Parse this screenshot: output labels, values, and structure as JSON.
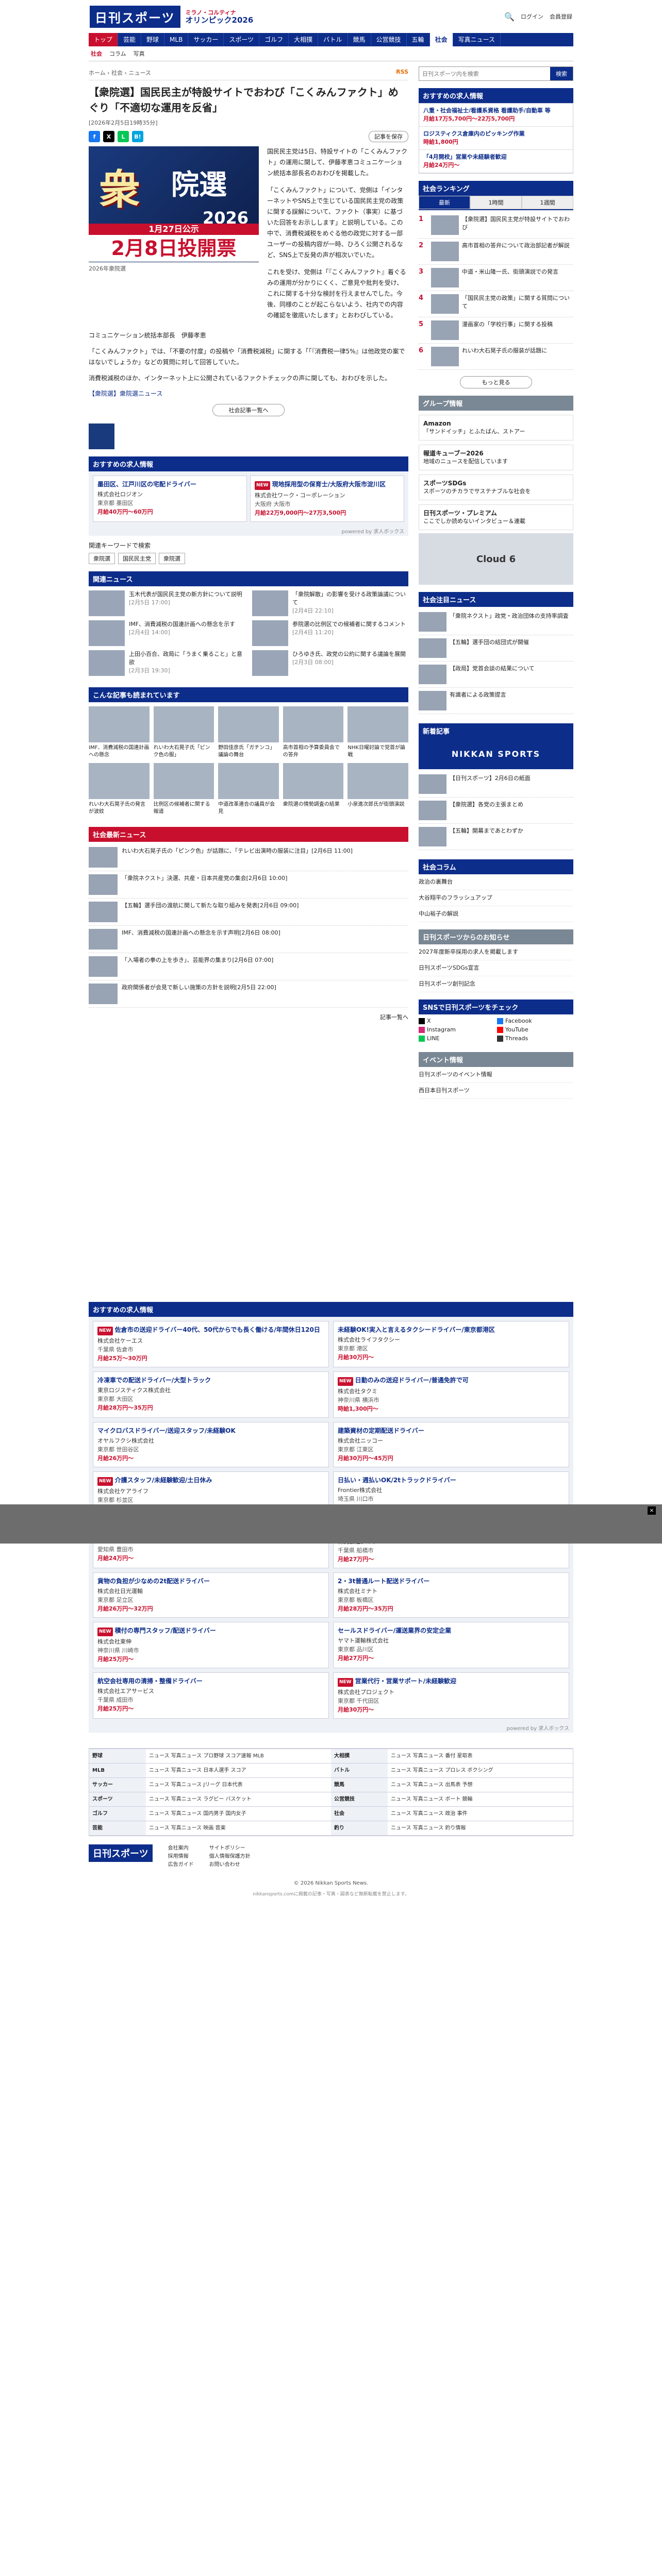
{
  "header": {
    "logo": "日刊スポーツ",
    "olympic_line1": "ミラノ・コルティナ",
    "olympic_line2": "オリンピック2026",
    "login": "ログイン",
    "member": "会員登録"
  },
  "nav": [
    "トップ",
    "芸能",
    "野球",
    "MLB",
    "サッカー",
    "スポーツ",
    "ゴルフ",
    "大相撲",
    "バトル",
    "競馬",
    "公営競技",
    "五輪",
    "社会",
    "写真ニュース"
  ],
  "subnav": [
    "社会",
    "コラム",
    "写真"
  ],
  "breadcrumb": "ホーム › 社会 › ニュース",
  "rss": "RSS",
  "article": {
    "title": "【衆院選】国民民主が特設サイトでおわび「こくみんファクト」めぐり「不適切な運用を反省」",
    "date": "[2026年2月5日19時35分]",
    "save": "記事を保存",
    "photo_band1": "1月27日公示",
    "photo_band2": "2月8日投開票",
    "caption": "2026年衆院選",
    "paragraphs": [
      "国民民主党は5日、特設サイトの「こくみんファクト」の運用に関して、伊藤孝恵コミュニケーション統括本部長名のおわびを掲載した。",
      "「こくみんファクト」について、党側は「インターネットやSNS上で生じている国民民主党の政策に関する誤解について、ファクト（事実）に基づいた回答をお示しします」と説明している。この中で、消費税減税をめぐる他の政党に対する一部ユーザーの投稿内容が一時、ひろく公開されるなど、SNS上で反発の声が相次いでいた。",
      "これを受け、党側は「『こくみんファクト』着ぐるみの運用が分かりにくく、ご意見や批判を受け、これに関する十分な検討を行えませんでした。今後、同様のことが起こらないよう、社内での内容の確認を徹底いたします」とおわびしている。",
      "コミュニケーション統括本部長　伊藤孝恵"
    ],
    "full": [
      "「こくみんファクト」では、「不要の忖度」の投稿や「消費税減税」に関する「「『消費税一律5%』は他政党の案ではないでしょうか」などの質問に対して回答していた。",
      "消費税減税のほか、インターネット上に公開されているファクトチェックの声に関しても、おわびを示した。"
    ],
    "related": "【衆院選】衆院選ニュース",
    "more": "社会記事一覧へ"
  },
  "jobs_top": {
    "heading": "おすすめの求人情報",
    "items": [
      {
        "title": "墨田区、江戸川区の宅配ドライバー",
        "company": "株式会社ロジオン",
        "loc": "東京都 墨田区",
        "pay": "月給40万円〜60万円"
      },
      {
        "title": "現地採用型の保育士/大阪府大阪市淀川区",
        "company": "株式会社ワーク・コーポレーション",
        "loc": "大阪府 大阪市",
        "pay": "月給22万9,000円〜27万3,500円"
      }
    ],
    "powered": "powered by 求人ボックス"
  },
  "keywords": {
    "label": "関連キーワードで検索",
    "tags": [
      "衆院選",
      "国民民主党",
      "衆院選"
    ]
  },
  "related_news": {
    "heading": "関連ニュース",
    "items": [
      {
        "text": "玉木代表が国民民主党の新方針について説明",
        "time": "[2月5日 17:00]"
      },
      {
        "text": "「衆院解散」の影響を受ける政策論議について",
        "time": "[2月4日 22:10]"
      },
      {
        "text": "IMF、消費減税の国連計画への懸念を示す",
        "time": "[2月4日 14:00]"
      },
      {
        "text": "参院選の比例区での候補者に関するコメント",
        "time": "[2月4日 11:20]"
      },
      {
        "text": "上田小百合、政局に「うまく乗ること」と意欲",
        "time": "[2月3日 19:30]"
      },
      {
        "text": "ひろゆき氏、政党の公約に関する議論を展開",
        "time": "[2月3日 08:00]"
      }
    ]
  },
  "photo_news": {
    "heading": "こんな記事も読まれています",
    "items": [
      "IMF、消費減税の国連計画への懸念",
      "れいわ大石晃子氏「ピンク色の服」",
      "野田佳彦氏「ガチンコ」議論の舞台",
      "高市首相の予算委員会での答弁",
      "NHK日曜討論で党首が論戦",
      "れいわ大石晃子氏の発言が波紋",
      "比例区の候補者に関する報道",
      "中道改革連合の議員が会見",
      "衆院選の情勢調査の結果",
      "小泉進次郎氏が街頭演説"
    ]
  },
  "society_news": {
    "heading": "社会最新ニュース",
    "items": [
      {
        "text": "れいわ大石晃子氏の「ピンク色」が話題に、「テレビ出演時の服装に注目」",
        "time": "[2月6日 11:00]"
      },
      {
        "text": "「衆院ネクスト」決選、共産・日本共産党の集会",
        "time": "[2月6日 10:00]"
      },
      {
        "text": "【五輪】選手団の渡航に関して新たな取り組みを発表",
        "time": "[2月6日 09:00]"
      },
      {
        "text": "IMF、消費減税の国連計画への懸念を示す声明",
        "time": "[2月6日 08:00]"
      },
      {
        "text": "「入場者の拳の上を歩き」、芸能界の集まり",
        "time": "[2月6日 07:00]"
      },
      {
        "text": "政府関係者が会見で新しい施策の方針を説明",
        "time": "[2月5日 22:00]"
      }
    ],
    "more": "記事一覧へ"
  },
  "jobs_bottom": {
    "heading": "おすすめの求人情報",
    "items": [
      {
        "title": "佐倉市の送迎ドライバー40代、50代からでも長く働ける/年間休日120日",
        "company": "株式会社ケーエス",
        "loc": "千葉県 佐倉市",
        "pay": "月給25万〜30万円"
      },
      {
        "title": "未経験OK!実入と言えるタクシードライバー/東京都港区",
        "company": "株式会社ライフタクシー",
        "loc": "東京都 港区",
        "pay": "月給30万円〜"
      },
      {
        "title": "冷凍車での配送ドライバー/大型トラック",
        "company": "東京ロジスティクス株式会社",
        "loc": "東京都 大田区",
        "pay": "月給28万円〜35万円"
      },
      {
        "title": "日勤のみの送迎ドライバー/普通免許で可",
        "company": "株式会社タクミ",
        "loc": "神奈川県 横浜市",
        "pay": "時給1,300円〜"
      },
      {
        "title": "マイクロバスドライバー/送迎スタッフ/未経験OK",
        "company": "オヤルフクシ株式会社",
        "loc": "東京都 世田谷区",
        "pay": "月給26万円〜"
      },
      {
        "title": "建築資材の定期配送ドライバー",
        "company": "株式会社ニッコー",
        "loc": "東京都 江東区",
        "pay": "月給30万円〜45万円"
      },
      {
        "title": "介護スタッフ/未経験歓迎/土日休み",
        "company": "株式会社ケアライフ",
        "loc": "東京都 杉並区",
        "pay": "月給24万円〜"
      },
      {
        "title": "日払い・週払いOK/2tトラックドライバー",
        "company": "Frontier株式会社",
        "loc": "埼玉県 川口市",
        "pay": "月給30万円〜"
      },
      {
        "title": "豊田営業所で倉庫スタッフの送迎ドライバー",
        "company": "フジパンス株式会社",
        "loc": "愛知県 豊田市",
        "pay": "月給24万円〜"
      },
      {
        "title": "普通免許で乗務ドライバー/週休2日",
        "company": "株式会社ダイワ",
        "loc": "千葉県 船橋市",
        "pay": "月給27万円〜"
      },
      {
        "title": "貨物の負担が少なめの2t配送ドライバー",
        "company": "株式会社日光運輸",
        "loc": "東京都 足立区",
        "pay": "月給26万円〜32万円"
      },
      {
        "title": "2・3t普通ルート配送ドライバー",
        "company": "株式会社ミナト",
        "loc": "東京都 板橋区",
        "pay": "月給28万円〜35万円"
      },
      {
        "title": "積付の専門スタッフ/配送ドライバー",
        "company": "株式会社東伸",
        "loc": "神奈川県 川崎市",
        "pay": "月給25万円〜"
      },
      {
        "title": "セールスドライバー/運送業界の安定企業",
        "company": "ヤマト運輸株式会社",
        "loc": "東京都 品川区",
        "pay": "月給27万円〜"
      },
      {
        "title": "航空会社専用の清掃・整備ドライバー",
        "company": "株式会社エアサービス",
        "loc": "千葉県 成田市",
        "pay": "月給25万円〜"
      },
      {
        "title": "営業代行・営業サポート/未経験歓迎",
        "company": "株式会社プロジェクト",
        "loc": "東京都 千代田区",
        "pay": "月給30万円〜"
      }
    ],
    "powered": "powered by 求人ボックス"
  },
  "side": {
    "search_placeholder": "日刊スポーツ内を検索",
    "search_btn": "検索",
    "jobs_heading": "おすすめの求人情報",
    "jobs": [
      {
        "title": "八重・社会福祉士/看護系資格 看護助手/自動車 等",
        "pay": "月給17万5,700円〜22万5,700円"
      },
      {
        "title": "ロジスティクス倉庫内のピッキング作業",
        "pay": "時給1,800円"
      },
      {
        "title": "「4月開校」営業や未経験者歓迎",
        "pay": "月給24万円〜"
      }
    ],
    "ranking_heading": "社会ランキング",
    "ranking_tabs": [
      "最新",
      "1時間",
      "1週間"
    ],
    "ranking": [
      "【衆院選】国民民主党が特設サイトでおわび",
      "高市首相の答弁について政治部記者が解説",
      "中道・米山隆一氏、街頭演説での発言",
      "「国民民主党の政策」に関する質問について",
      "漫画家の「学校行事」に関する投稿",
      "れいわ大石晃子氏の服装が話題に"
    ],
    "ranking_more": "もっと見る",
    "group_heading": "グループ情報",
    "ads": [
      {
        "head": "Amazon",
        "text": "「サンドイッチ」とふたばん、ストアー"
      },
      {
        "head": "報道キューブー2026",
        "text": "地域のニュースを配信しています"
      },
      {
        "head": "スポーツSDGs",
        "text": "スポーツのチカラでサステナブルな社会を"
      },
      {
        "head": "日刊スポーツ・プレミアム",
        "text": "ここでしか読めないインタビュー＆連載"
      }
    ],
    "ad_image": "Cloud 6",
    "society_heading": "社会注目ニュース",
    "society": [
      "「衆院ネクスト」政党・政治団体の支持率調査",
      "【五輪】選手団の結団式が開催",
      "【政局】党首会談の結果について",
      "有識者による政策提言"
    ],
    "newspaper": "NIKKAN SPORTS",
    "newspaper_heading": "新着記事",
    "newspaper_items": [
      "【日刊スポーツ】2月6日の紙面",
      "【衆院選】各党の主張まとめ",
      "【五輪】開幕まであとわずか"
    ],
    "column_heading": "社会コラム",
    "columns": [
      "政治の裏舞台",
      "大谷翔平のフラッシュアップ",
      "中山裕子の解説"
    ],
    "events_heading": "日刊スポーツからのお知らせ",
    "events": [
      "2027年度新卒採用の求人を掲載します",
      "日刊スポーツSDGs宣言",
      "日刊スポーツ創刊記念"
    ],
    "sns_heading": "SNSで日刊スポーツをチェック",
    "sns": [
      "X",
      "Facebook",
      "Instagram",
      "YouTube",
      "LINE",
      "Threads"
    ],
    "event_heading": "イベント情報",
    "event_items": [
      "日刊スポーツのイベント情報",
      "西日本日刊スポーツ"
    ]
  },
  "footer": {
    "rows": [
      {
        "h": "野球",
        "l": "ニュース 写真ニュース プロ野球 スコア速報 MLB"
      },
      {
        "h": "大相撲",
        "l": "ニュース 写真ニュース 番付 星取表"
      },
      {
        "h": "MLB",
        "l": "ニュース 写真ニュース 日本人選手 スコア"
      },
      {
        "h": "バトル",
        "l": "ニュース 写真ニュース プロレス ボクシング"
      },
      {
        "h": "サッカー",
        "l": "ニュース 写真ニュース Jリーグ 日本代表"
      },
      {
        "h": "競馬",
        "l": "ニュース 写真ニュース 出馬表 予想"
      },
      {
        "h": "スポーツ",
        "l": "ニュース 写真ニュース ラグビー バスケット"
      },
      {
        "h": "公営競技",
        "l": "ニュース 写真ニュース ボート 競輪"
      },
      {
        "h": "ゴルフ",
        "l": "ニュース 写真ニュース 国内男子 国内女子"
      },
      {
        "h": "社会",
        "l": "ニュース 写真ニュース 政治 事件"
      },
      {
        "h": "芸能",
        "l": "ニュース 写真ニュース 映画 音楽"
      },
      {
        "h": "釣り",
        "l": "ニュース 写真ニュース 釣り情報"
      }
    ],
    "bottom_logo": "日刊スポーツ",
    "bottom_cols": [
      [
        "会社案内",
        "採用情報",
        "広告ガイド"
      ],
      [
        "サイトポリシー",
        "個人情報保護方針",
        "お問い合わせ"
      ]
    ],
    "copyright": "© 2026 Nikkan Sports News.",
    "copyright2": "nikkansports.comに掲載の記事・写真・図表など無断転載を禁止します。"
  }
}
